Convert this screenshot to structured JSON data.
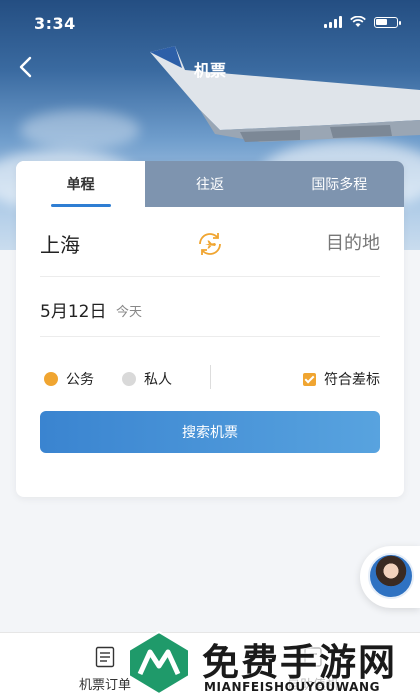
{
  "status_bar": {
    "time": "3:34"
  },
  "nav": {
    "title": "机票",
    "back_icon": "chevron-left-icon"
  },
  "tabs": [
    {
      "label": "单程",
      "active": true
    },
    {
      "label": "往返",
      "active": false
    },
    {
      "label": "国际多程",
      "active": false
    }
  ],
  "trip": {
    "from_city": "上海",
    "to_placeholder": "目的地",
    "swap_icon": "swap-plane-icon",
    "date": "5月12日",
    "date_hint": "今天"
  },
  "purpose": {
    "options": [
      {
        "label": "公务",
        "selected": true,
        "color": "#f0a531"
      },
      {
        "label": "私人",
        "selected": false,
        "color": "#d9d9d9"
      }
    ],
    "policy_label": "符合差标",
    "policy_checked": true
  },
  "search_button": "搜索机票",
  "bottom_bar": {
    "orders_label": "机票订单",
    "self_checkin_label": "自助值机"
  },
  "watermark": {
    "title": "免费手游网",
    "subtitle": "MIANFEISHOUYOUWANG"
  },
  "colors": {
    "accent": "#2f7ed3",
    "orange": "#f0a531",
    "button_start": "#3a84d0",
    "button_end": "#58a3df"
  }
}
